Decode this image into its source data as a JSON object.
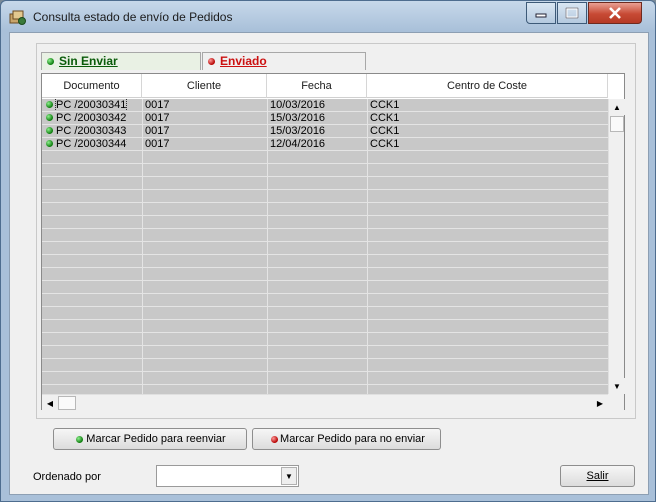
{
  "window": {
    "title": "Consulta estado de envío de Pedidos"
  },
  "tabs": [
    {
      "label": "Sin Enviar",
      "color": "#0a5c0a",
      "status": "green"
    },
    {
      "label": "Enviado",
      "color": "#cc1111",
      "status": "red"
    }
  ],
  "grid": {
    "columns": [
      "Documento",
      "Cliente",
      "Fecha",
      "Centro de Coste"
    ],
    "rows": [
      {
        "documento": "PC /20030341",
        "cliente": "0017",
        "fecha": "10/03/2016",
        "centro": "CCK1"
      },
      {
        "documento": "PC /20030342",
        "cliente": "0017",
        "fecha": "15/03/2016",
        "centro": "CCK1"
      },
      {
        "documento": "PC /20030343",
        "cliente": "0017",
        "fecha": "15/03/2016",
        "centro": "CCK1"
      },
      {
        "documento": "PC /20030344",
        "cliente": "0017",
        "fecha": "12/04/2016",
        "centro": "CCK1"
      }
    ]
  },
  "buttons": {
    "reenviar": "Marcar Pedido para reenviar",
    "no_enviar": "Marcar Pedido para no enviar",
    "salir": "Salir"
  },
  "footer": {
    "ordenado_label": "Ordenado por",
    "ordenado_value": ""
  },
  "colors": {
    "titlebar": "#a9c0d9",
    "row_bg": "#c8c8c8",
    "close_button": "#c74a35"
  }
}
